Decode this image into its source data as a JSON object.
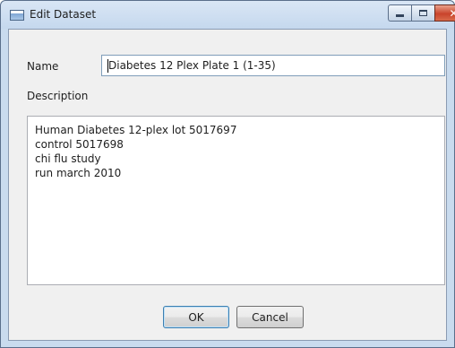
{
  "window": {
    "title": "Edit Dataset",
    "icon": "window-app-icon",
    "caption_buttons": {
      "minimize": "minimize-icon",
      "maximize": "maximize-icon",
      "close_label": "✕"
    }
  },
  "form": {
    "name_label": "Name",
    "name_value": "Diabetes 12 Plex Plate 1 (1-35)",
    "description_label": "Description",
    "description_lines": [
      "Human Diabetes 12-plex lot 5017697",
      "control 5017698",
      "chi flu study",
      "run march 2010"
    ]
  },
  "buttons": {
    "ok": "OK",
    "cancel": "Cancel"
  },
  "colors": {
    "titlebar": "#c5d8ee",
    "close_button": "#c9432b",
    "client_bg": "#f0f0f0"
  }
}
